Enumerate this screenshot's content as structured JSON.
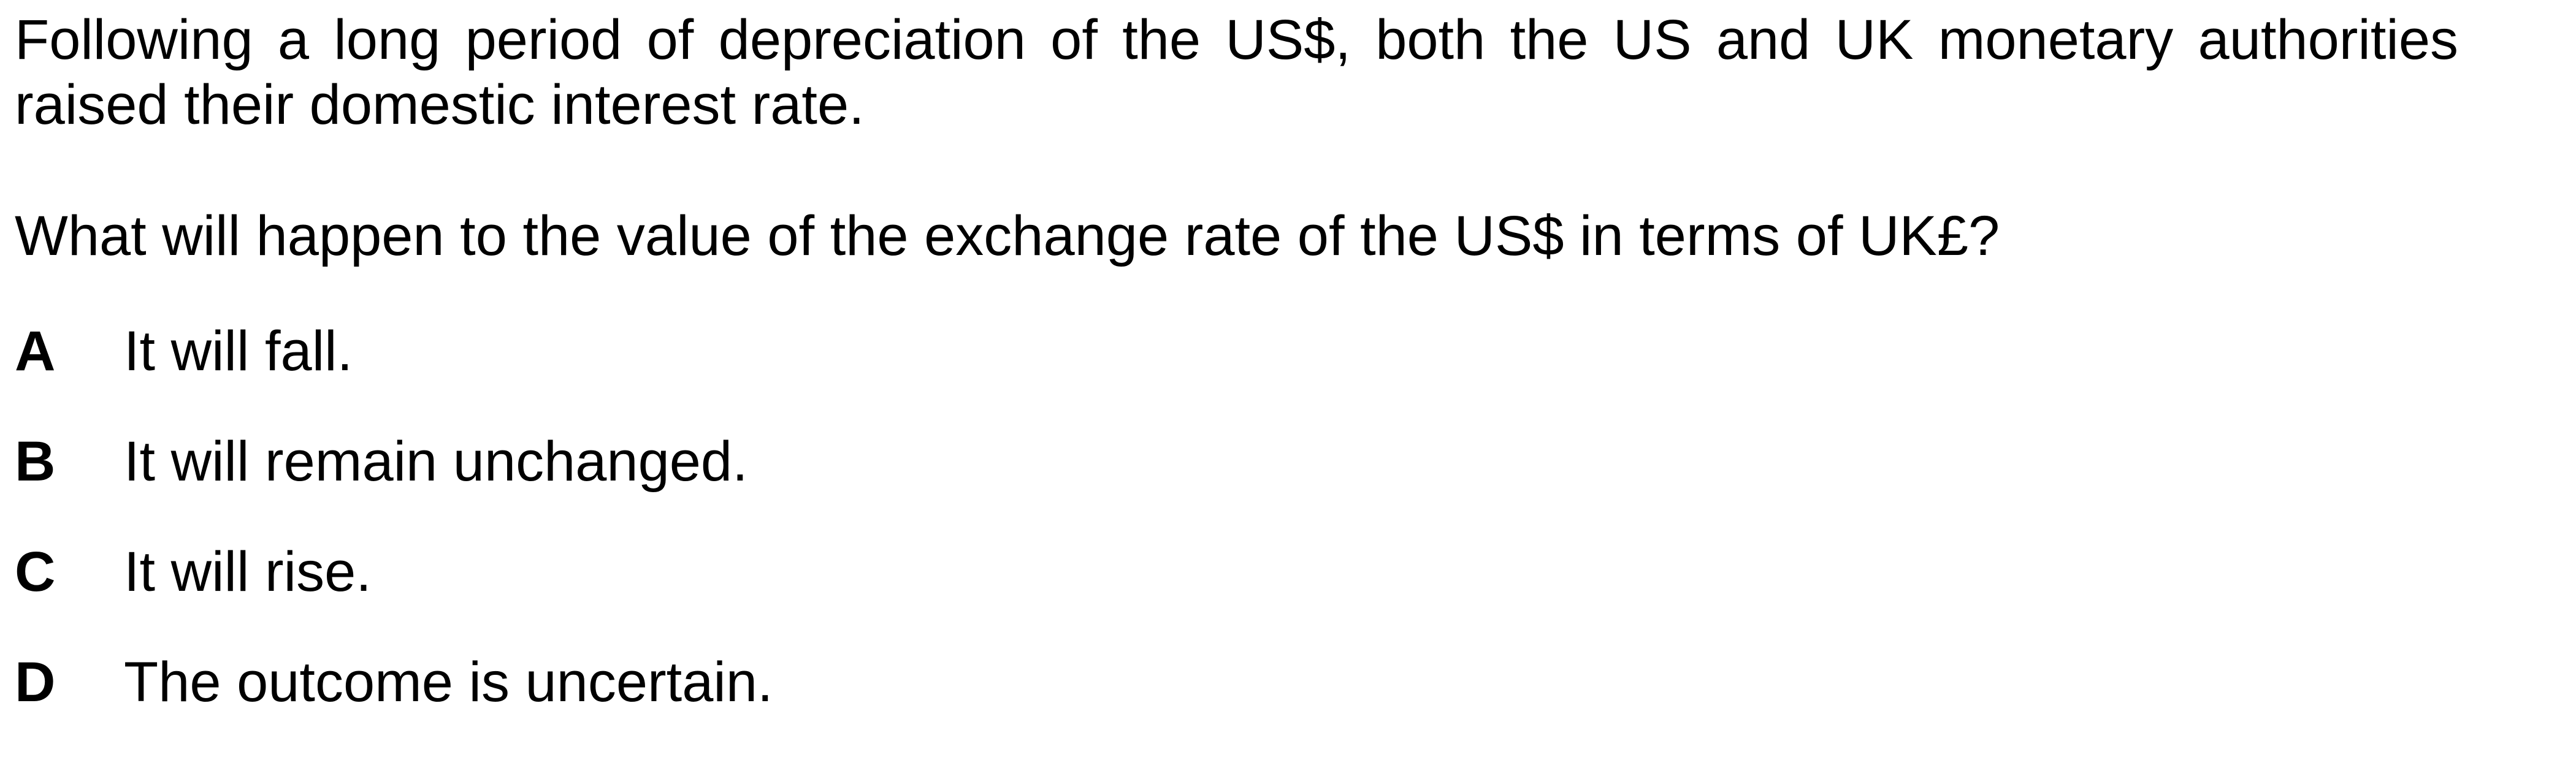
{
  "question": {
    "stem": "Following a long period of depreciation of the US$, both the US and UK monetary authorities raised their domestic interest rate.",
    "prompt": "What will happen to the value of the exchange rate of the US$ in terms of UK£?",
    "options": [
      {
        "letter": "A",
        "text": "It will fall."
      },
      {
        "letter": "B",
        "text": "It will remain unchanged."
      },
      {
        "letter": "C",
        "text": "It will rise."
      },
      {
        "letter": "D",
        "text": "The outcome is uncertain."
      }
    ]
  }
}
